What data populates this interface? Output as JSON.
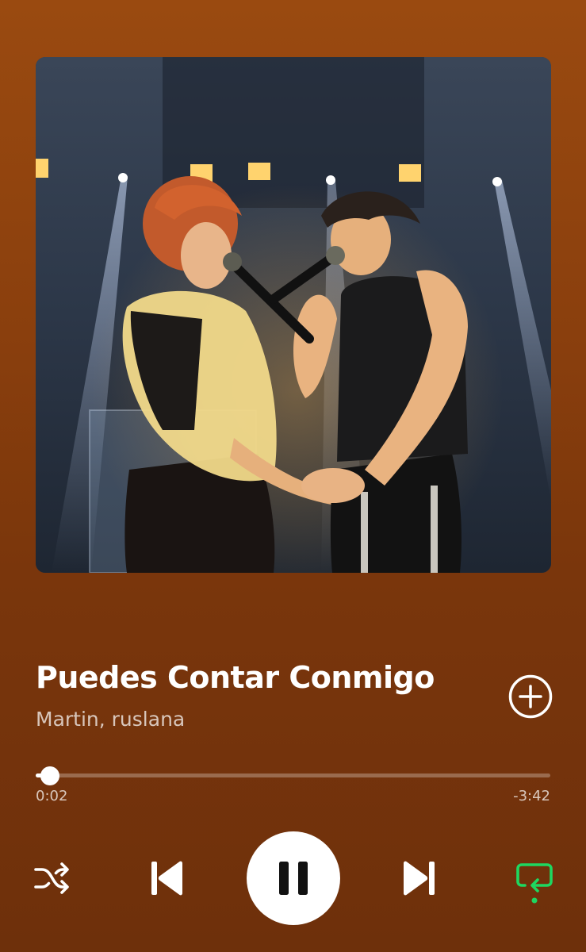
{
  "player": {
    "track_title": "Puedes Contar Conmigo",
    "artists": "Martin, ruslana",
    "elapsed": "0:02",
    "remaining": "-3:42",
    "progress_fraction": 0.009,
    "repeat_active": true
  },
  "icons": {
    "add": "plus-circle-icon",
    "shuffle": "shuffle-icon",
    "previous": "skip-previous-icon",
    "pause": "pause-icon",
    "next": "skip-next-icon",
    "repeat": "repeat-icon"
  },
  "colors": {
    "background_top": "#9a4a10",
    "background_bottom": "#6e300b",
    "accent_green": "#1ed760",
    "text_secondary": "rgba(255,255,255,0.72)"
  }
}
